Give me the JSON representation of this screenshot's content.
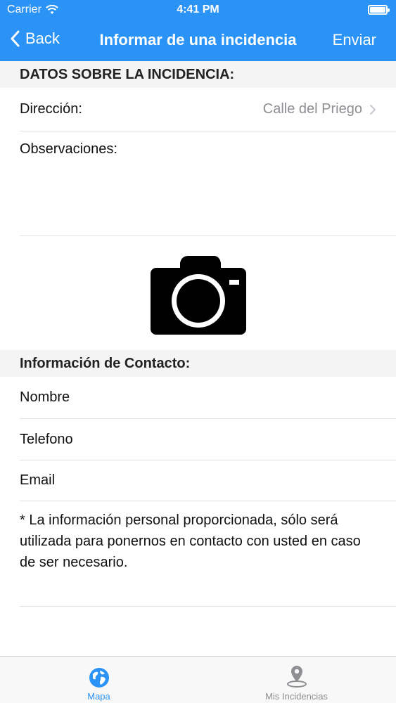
{
  "status_bar": {
    "carrier": "Carrier",
    "time": "4:41 PM"
  },
  "nav": {
    "back_label": "Back",
    "title": "Informar de una incidencia",
    "send_label": "Enviar"
  },
  "incident": {
    "section_title": "DATOS SOBRE LA INCIDENCIA:",
    "address_label": "Dirección:",
    "address_value": "Calle del Priego",
    "notes_label": "Observaciones:"
  },
  "contact": {
    "section_title": "Información de Contacto:",
    "name_label": "Nombre",
    "phone_label": "Telefono",
    "email_label": "Email",
    "note": "* La información personal proporcionada, sólo será utilizada para ponernos en contacto con usted en caso de ser necesario."
  },
  "tabbar": {
    "tabs": [
      {
        "label": "Mapa",
        "icon": "globe-icon",
        "active": true
      },
      {
        "label": "Mis Incidencias",
        "icon": "map-pin-icon",
        "active": false
      }
    ]
  },
  "colors": {
    "accent": "#2b93f5",
    "section_bg": "#f4f4f4",
    "secondary_text": "#8e8e93"
  }
}
